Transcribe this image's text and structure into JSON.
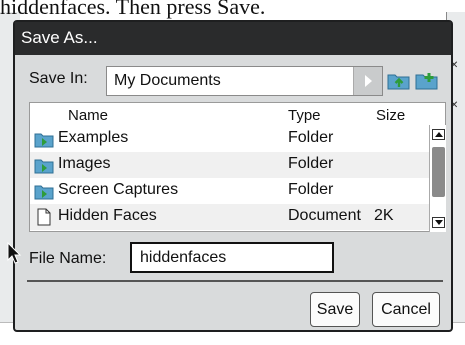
{
  "background": {
    "caption": "hiddenfaces. Then press Save."
  },
  "dialog": {
    "title": "Save As...",
    "save_in_label": "Save In:",
    "save_in_value": "My Documents",
    "icons": [
      "folder-up-icon",
      "new-folder-icon"
    ],
    "columns": {
      "name": "Name",
      "type": "Type",
      "size": "Size"
    },
    "files": [
      {
        "name": "Examples",
        "type": "Folder",
        "size": "",
        "icon": "folder-icon"
      },
      {
        "name": "Images",
        "type": "Folder",
        "size": "",
        "icon": "folder-icon"
      },
      {
        "name": "Screen Captures",
        "type": "Folder",
        "size": "",
        "icon": "folder-icon"
      },
      {
        "name": "Hidden Faces",
        "type": "Document",
        "size": "2K",
        "icon": "document-icon"
      }
    ],
    "file_name_label": "File Name:",
    "file_name_value": "hiddenfaces",
    "save_label": "Save",
    "cancel_label": "Cancel"
  },
  "colors": {
    "titlebar": "#2a2b2c",
    "dialog_bg": "#d9dbdc",
    "folder_icon": "#4a90b8"
  }
}
